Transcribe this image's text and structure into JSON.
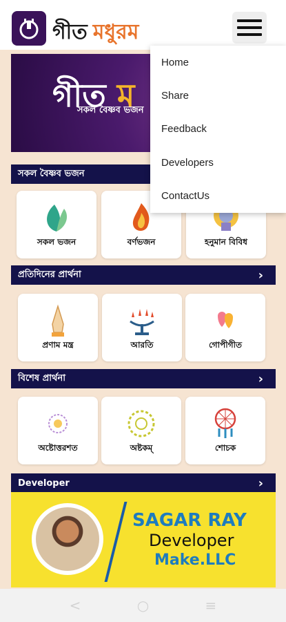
{
  "app": {
    "title_part1": "গীত",
    "title_part2": "মধুরম"
  },
  "banner": {
    "title_part1": "গীত",
    "title_part2": "ম",
    "subtitle": "সকল বৈষ্ণব ভজন"
  },
  "sections": [
    {
      "title": "সকল বৈষ্ণব ভজন",
      "items": [
        {
          "label": "সকল ভজন",
          "icon": "leaf-icon"
        },
        {
          "label": "বর্ণভজন",
          "icon": "flame-icon"
        },
        {
          "label": "হনুমান বিবিধ",
          "icon": "hanuman-icon"
        }
      ]
    },
    {
      "title": "প্রতিদিনের প্রার্থনা",
      "items": [
        {
          "label": "প্রণাম মন্ত্র",
          "icon": "praying-hands-icon"
        },
        {
          "label": "আরতি",
          "icon": "aarti-lamp-icon"
        },
        {
          "label": "গোপীগীত",
          "icon": "hearts-icon"
        }
      ]
    },
    {
      "title": "বিশেষ প্রার্থনা",
      "items": [
        {
          "label": "অষ্টোত্তরশত",
          "icon": "lotus-icon"
        },
        {
          "label": "অষ্টকম্",
          "icon": "sun-mandala-icon"
        },
        {
          "label": "শোচক",
          "icon": "dreamcatcher-icon"
        }
      ]
    }
  ],
  "developer_section": {
    "title": "Developer",
    "name": "SAGAR RAY",
    "role": "Developer",
    "company": "Make.LLC"
  },
  "menu": {
    "items": [
      "Home",
      "Share",
      "Feedback",
      "Developers",
      "ContactUs"
    ]
  },
  "navbar": {
    "back": "<",
    "home": "○",
    "recents": "≡"
  },
  "colors": {
    "header_bg": "#14124a",
    "brand_purple": "#3a1259",
    "brand_orange": "#e8742c",
    "developer_banner": "#f7e12e",
    "developer_blue": "#1e7cbe"
  }
}
